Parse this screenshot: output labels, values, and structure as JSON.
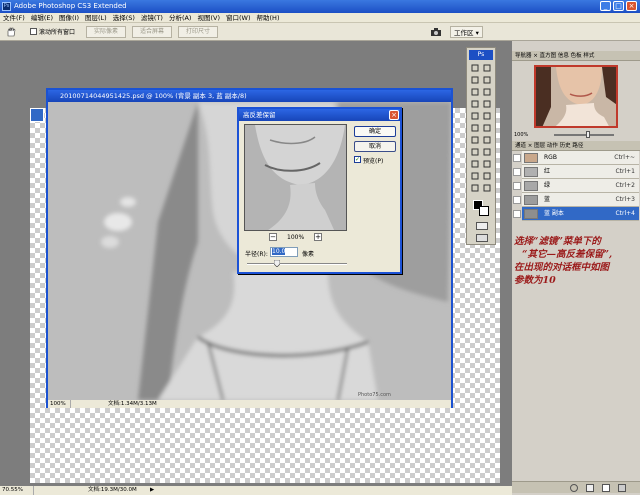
{
  "app": {
    "title": "Adobe Photoshop CS3 Extended",
    "window_controls": [
      "_",
      "□",
      "×"
    ]
  },
  "menu": [
    "文件(F)",
    "编辑(E)",
    "图像(I)",
    "图层(L)",
    "选择(S)",
    "滤镜(T)",
    "分析(A)",
    "视图(V)",
    "窗口(W)",
    "帮助(H)"
  ],
  "options": {
    "autoselect_label": "滚动所有窗口",
    "btn_actual": "实际像素",
    "btn_fit": "适合屏幕",
    "btn_print": "打印尺寸",
    "workspace": "工作区 ▾"
  },
  "document": {
    "title": "20100714044951425.psd @ 100% (背景 副本 3, 蓝 副本/8)",
    "zoom": "100%",
    "doc_info": "文档:1.34M/3.13M",
    "watermark": "Photo75.com"
  },
  "dialog": {
    "title": "高反差保留",
    "ok": "确定",
    "cancel": "取消",
    "preview_label": "预览(P)",
    "preview_checked": true,
    "zoom": "100%",
    "radius_label": "半径(R):",
    "radius_value": "10.0",
    "unit": "像素",
    "slider_fraction": 0.3
  },
  "navigator": {
    "tabs": [
      "导航器",
      "直方图",
      "信息",
      "色板",
      "样式"
    ],
    "zoom": "100%"
  },
  "layers": {
    "tabs": [
      "通道",
      "图层",
      "动作",
      "历史",
      "路径"
    ],
    "rows": [
      {
        "name": "RGB",
        "shortcut": "Ctrl+~",
        "selected": false
      },
      {
        "name": "红",
        "shortcut": "Ctrl+1",
        "selected": false
      },
      {
        "name": "绿",
        "shortcut": "Ctrl+2",
        "selected": false
      },
      {
        "name": "蓝",
        "shortcut": "Ctrl+3",
        "selected": false
      },
      {
        "name": "蓝 副本",
        "shortcut": "Ctrl+4",
        "selected": true
      }
    ]
  },
  "annotation": {
    "line1": "选择“滤镜”菜单下的",
    "line2": "“其它—高反差保留”,",
    "line3": "在出现的对话框中如图",
    "line4": "参数为10"
  },
  "status": {
    "zoom": "70.55%",
    "doc_info": "文档:19.3M/30.0M"
  },
  "colors": {
    "title_blue": "#1b52d2",
    "annotation_red": "#9b1a1a",
    "selected_layer": "#3169c6"
  }
}
